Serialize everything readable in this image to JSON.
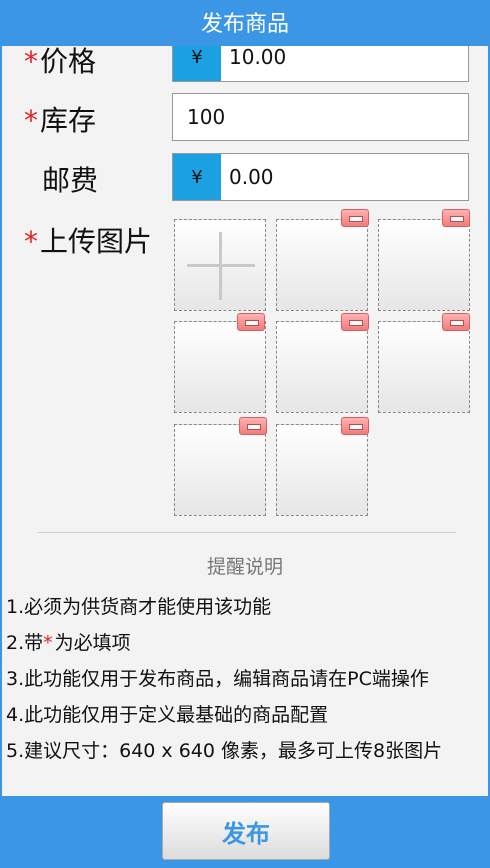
{
  "header": {
    "title": "发布商品"
  },
  "form": {
    "price": {
      "required_mark": "*",
      "label": "价格",
      "currency": "¥",
      "value": "10.00"
    },
    "stock": {
      "required_mark": "*",
      "label": "库存",
      "value": "100"
    },
    "shipping": {
      "label": "邮费",
      "currency": "¥",
      "value": "0.00"
    },
    "images": {
      "required_mark": "*",
      "label": "上传图片",
      "uploaded_count": 7
    }
  },
  "notes": {
    "title": "提醒说明",
    "items": [
      "1.必须为供货商才能使用该功能",
      "3.此功能仅用于发布商品，编辑商品请在PC端操作",
      "4.此功能仅用于定义最基础的商品配置",
      "5.建议尺寸：640 x 640 像素，最多可上传8张图片"
    ],
    "item2": {
      "prefix": "2.带",
      "mark": "*",
      "suffix": "为必填项"
    }
  },
  "footer": {
    "publish_label": "发布"
  },
  "colors": {
    "accent": "#3c96e6",
    "currency_bg": "#1ba1e2",
    "required": "#e52121",
    "remove_button": "#ef7c7c"
  },
  "icons": {
    "add": "plus-icon",
    "remove": "minus-icon"
  }
}
